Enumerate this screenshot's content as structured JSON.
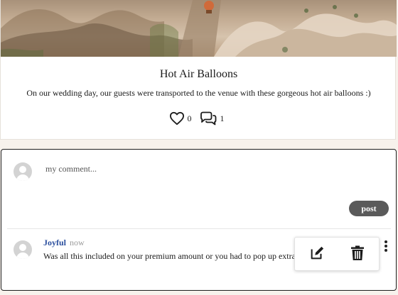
{
  "post": {
    "title": "Hot Air Balloons",
    "description": "On our wedding day, our guests were transported to the venue with these gorgeous hot air balloons :)",
    "like_count": "0",
    "comment_count": "1"
  },
  "comment_form": {
    "placeholder": "my comment...",
    "post_label": "post"
  },
  "comments": [
    {
      "author": "Joyful",
      "time": "now",
      "text": "Was all this included on your premium amount or you had to pop up extra for the Balloons?"
    }
  ],
  "icons": {
    "like": "heart-icon",
    "comments": "chat-bubbles-icon",
    "edit": "edit-icon",
    "delete": "trash-icon",
    "more": "kebab-icon"
  },
  "colors": {
    "author_link": "#2b4f9e",
    "post_button": "#5a5a5a",
    "page_background": "#f7f2ec"
  }
}
